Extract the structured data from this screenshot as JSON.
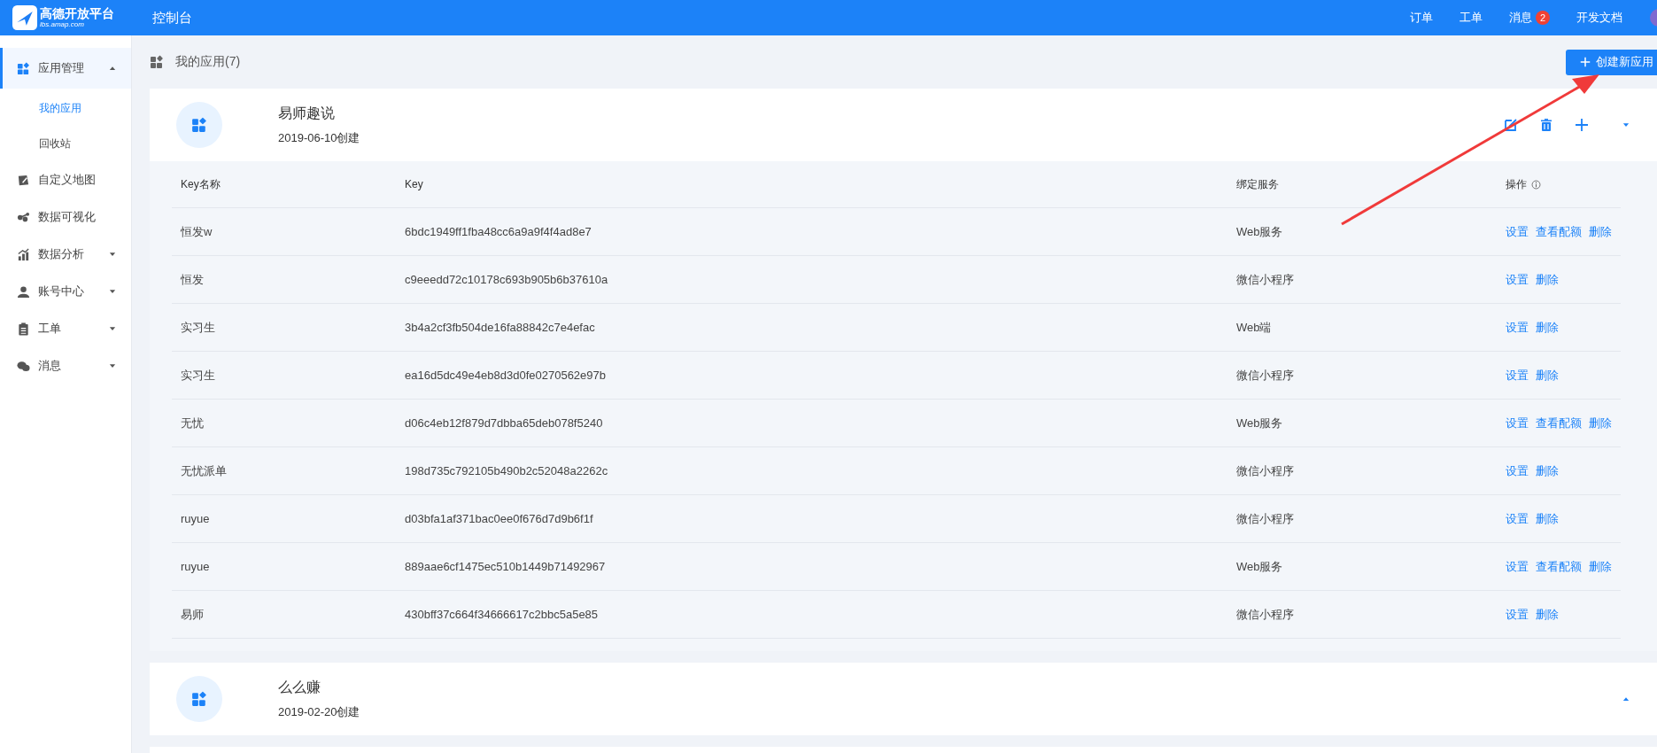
{
  "topbar": {
    "logo_title": "高德开放平台",
    "logo_subtitle": "lbs.amap.com",
    "console": "控制台",
    "nav": [
      {
        "label": "订单"
      },
      {
        "label": "工单"
      },
      {
        "label": "消息",
        "badge": "2"
      },
      {
        "label": "开发文档"
      }
    ]
  },
  "sidebar": {
    "items": [
      {
        "label": "应用管理",
        "expanded": true,
        "children": [
          {
            "label": "我的应用",
            "selected": true
          },
          {
            "label": "回收站",
            "selected": false
          }
        ]
      },
      {
        "label": "自定义地图"
      },
      {
        "label": "数据可视化"
      },
      {
        "label": "数据分析",
        "expanded": false
      },
      {
        "label": "账号中心",
        "expanded": false
      },
      {
        "label": "工单",
        "expanded": false
      },
      {
        "label": "消息",
        "expanded": false
      }
    ]
  },
  "header": {
    "title": "我的应用(7)",
    "create_button": "创建新应用"
  },
  "apps": [
    {
      "title": "易师趣说",
      "created": "2019-06-10创建",
      "expanded": true,
      "tools_shown": true,
      "table": {
        "columns": [
          "Key名称",
          "Key",
          "绑定服务",
          "操作"
        ],
        "rows": [
          {
            "name": "恒发w",
            "key": "6bdc1949ff1fba48cc6a9a9f4f4ad8e7",
            "service": "Web服务",
            "actions": [
              "设置",
              "查看配额",
              "删除"
            ]
          },
          {
            "name": "恒发",
            "key": "c9eeedd72c10178c693b905b6b37610a",
            "service": "微信小程序",
            "actions": [
              "设置",
              "删除"
            ]
          },
          {
            "name": "实习生",
            "key": "3b4a2cf3fb504de16fa88842c7e4efac",
            "service": "Web端",
            "actions": [
              "设置",
              "删除"
            ]
          },
          {
            "name": "实习生",
            "key": "ea16d5dc49e4eb8d3d0fe0270562e97b",
            "service": "微信小程序",
            "actions": [
              "设置",
              "删除"
            ]
          },
          {
            "name": "无忧",
            "key": "d06c4eb12f879d7dbba65deb078f5240",
            "service": "Web服务",
            "actions": [
              "设置",
              "查看配额",
              "删除"
            ]
          },
          {
            "name": "无忧派单",
            "key": "198d735c792105b490b2c52048a2262c",
            "service": "微信小程序",
            "actions": [
              "设置",
              "删除"
            ]
          },
          {
            "name": "ruyue",
            "key": "d03bfa1af371bac0ee0f676d7d9b6f1f",
            "service": "微信小程序",
            "actions": [
              "设置",
              "删除"
            ]
          },
          {
            "name": "ruyue",
            "key": "889aae6cf1475ec510b1449b71492967",
            "service": "Web服务",
            "actions": [
              "设置",
              "查看配额",
              "删除"
            ]
          },
          {
            "name": "易师",
            "key": "430bff37c664f34666617c2bbc5a5e85",
            "service": "微信小程序",
            "actions": [
              "设置",
              "删除"
            ]
          }
        ]
      }
    },
    {
      "title": "么么赚",
      "created": "2019-02-20创建",
      "expanded": false,
      "tools_shown": false
    }
  ]
}
